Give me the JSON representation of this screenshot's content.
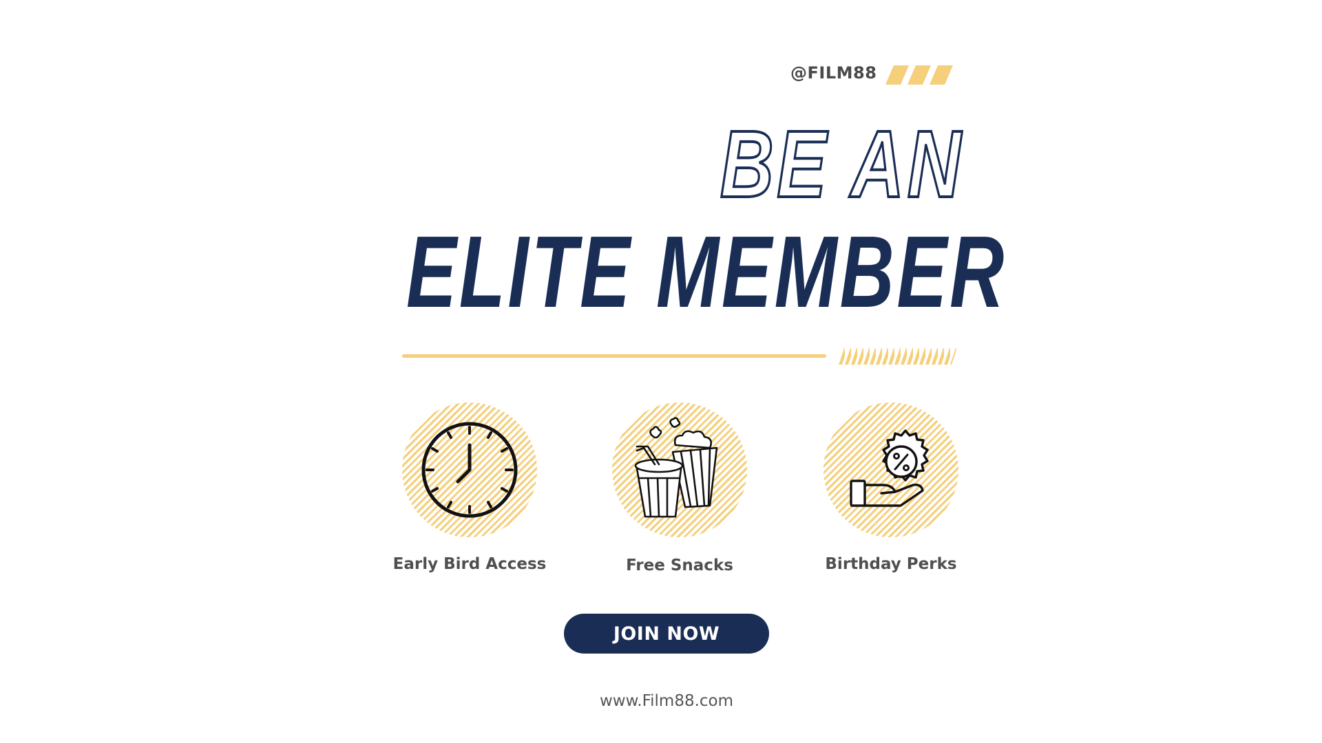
{
  "brand": {
    "handle": "@FILM88",
    "website": "www.Film88.com"
  },
  "headline": {
    "line1": "BE AN",
    "line2": "ELITE MEMBER"
  },
  "features": [
    {
      "label": "Early Bird Access",
      "icon": "clock-icon"
    },
    {
      "label": "Free Snacks",
      "icon": "popcorn-drink-icon"
    },
    {
      "label": "Birthday Perks",
      "icon": "discount-hand-icon"
    }
  ],
  "cta": {
    "label": "JOIN NOW"
  },
  "colors": {
    "navy": "#1a2d55",
    "accent_yellow": "#f5cf7a",
    "text_gray": "#4f4f4f",
    "background": "#ffffff"
  }
}
